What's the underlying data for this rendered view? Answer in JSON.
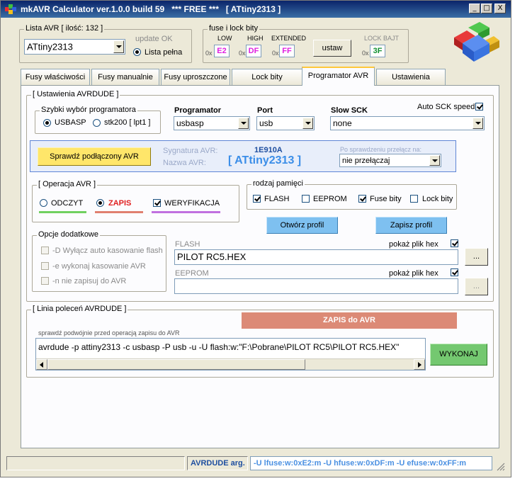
{
  "title": "mkAVR Calculator ver.1.0.0 build 59   *** FREE ***   [ ATtiny2313 ]",
  "window_buttons": {
    "minimize": "_",
    "maximize": "□",
    "close": "X"
  },
  "avr_list": {
    "label": "Lista AVR [ ilość: 132 ]",
    "selected": "ATtiny2313",
    "update_status": "update OK",
    "full_list_label": "Lista pełna"
  },
  "fuses": {
    "label": "fuse i lock bity",
    "low_label": "LOW",
    "low_prefix": "0x",
    "low_value": "E2",
    "high_label": "HIGH",
    "high_prefix": "0x",
    "high_value": "DF",
    "ext_label": "EXTENDED",
    "ext_prefix": "0x",
    "ext_value": "FF",
    "set_button": "ustaw",
    "lock_label": "LOCK BAJT",
    "lock_prefix": "0x",
    "lock_value": "3F"
  },
  "tabs": [
    "Fusy właściwości",
    "Fusy manualnie",
    "Fusy uproszczone",
    "Lock bity",
    "Programator AVR",
    "Ustawienia"
  ],
  "active_tab": "Programator AVR",
  "avrdude_settings": {
    "label": "[ Ustawienia AVRDUDE ]",
    "quick_select_label": "Szybki wybór programatora",
    "usbasp_label": "USBASP",
    "stk200_label": "stk200 [ lpt1 ]",
    "programmer_label": "Programator",
    "programmer_value": "usbasp",
    "port_label": "Port",
    "port_value": "usb",
    "slow_sck_label": "Slow SCK",
    "slow_sck_value": "none",
    "auto_sck_label": "Auto SCK speed"
  },
  "verify": {
    "button": "Sprawdź podłączony AVR",
    "signature_label": "Sygnatura AVR:",
    "signature_value": "1E910A",
    "name_label": "Nazwa AVR:",
    "name_value": "[ ATtiny2313 ]",
    "after_check_label": "Po sprawdzeniu przełącz na:",
    "after_check_value": "nie przełączaj"
  },
  "operation": {
    "label": "[ Operacja AVR ]",
    "read_label": "ODCZYT",
    "write_label": "ZAPIS",
    "verify_label": "WERYFIKACJA"
  },
  "memory_type": {
    "label": "rodzaj pamięci",
    "flash_label": "FLASH",
    "eeprom_label": "EEPROM",
    "fuse_label": "Fuse bity",
    "lock_label": "Lock bity"
  },
  "profile": {
    "open": "Otwórz profil",
    "save": "Zapisz profil"
  },
  "options": {
    "label": "Opcje dodatkowe",
    "opt1": "-D Wyłącz auto kasowanie flash",
    "opt2": "-e wykonaj kasowanie AVR",
    "opt3": "-n nie zapisuj do AVR"
  },
  "flash_file": {
    "label": "FLASH",
    "show_hex_label": "pokaż plik hex",
    "value": "PILOT RC5.HEX",
    "browse": "..."
  },
  "eeprom_file": {
    "label": "EEPROM",
    "show_hex_label": "pokaż plik hex",
    "value": "",
    "browse": "..."
  },
  "command": {
    "label": "[ Linia poleceń AVRDUDE ]",
    "banner": "ZAPIS do AVR",
    "hint": "sprawdź podwójnie przed operacją zapisu do AVR",
    "value": "avrdude -p attiny2313 -c usbasp -P usb -u  -U flash:w:\"F:\\Pobrane\\PILOT RC5\\PILOT RC5.HEX\"",
    "execute": "WYKONAJ"
  },
  "status": {
    "args_label": "AVRDUDE arg.",
    "args_value": "-U lfuse:w:0xE2:m  -U hfuse:w:0xDF:m  -U efuse:w:0xFF:m"
  },
  "colors": {
    "low_fuse": "#e020e0",
    "high_fuse": "#e020e0",
    "ext_fuse": "#e020e0",
    "lock": "#109030",
    "signature": "#1f4fa0",
    "name": "#3b8ee8",
    "write": "#e02020",
    "banner": "#dc8a76",
    "read_bar": "#70d060",
    "write_bar": "#e08070",
    "verify_bar": "#c070e0",
    "accent_blue": "#4a90e2"
  }
}
